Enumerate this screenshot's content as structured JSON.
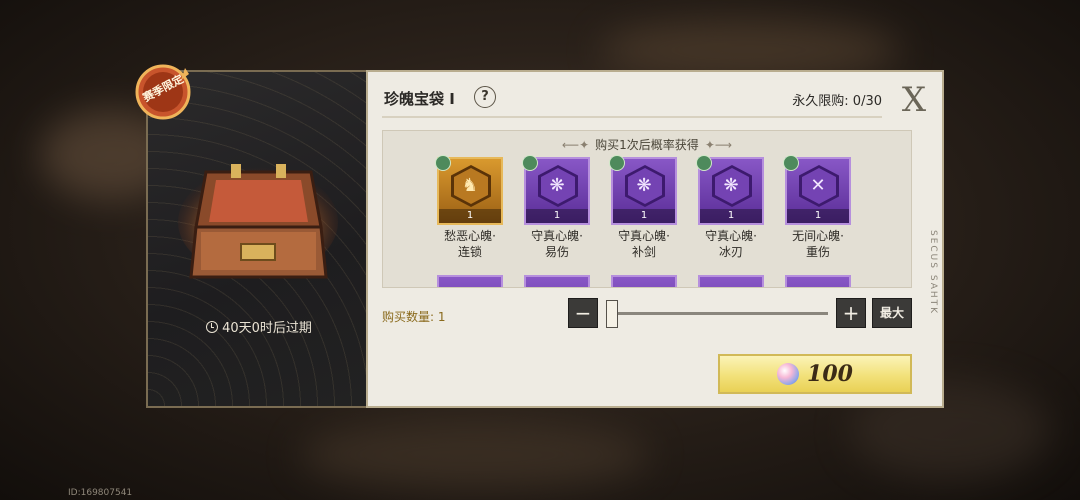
{
  "season_badge": "赛季限定",
  "chest": {
    "expire_text": "40天0时后过期"
  },
  "header": {
    "title": "珍魄宝袋 I",
    "help_symbol": "?",
    "limit_text": "永久限购: 0/30",
    "close_symbol": "X"
  },
  "items_caption": "购买1次后概率获得",
  "items": [
    {
      "name_line1": "愁恶心魄·",
      "name_line2": "连锁",
      "count": "1",
      "rarity": "gold",
      "glyph": "♞"
    },
    {
      "name_line1": "守真心魄·",
      "name_line2": "易伤",
      "count": "1",
      "rarity": "purple",
      "glyph": "❋"
    },
    {
      "name_line1": "守真心魄·",
      "name_line2": "补剑",
      "count": "1",
      "rarity": "purple",
      "glyph": "❋"
    },
    {
      "name_line1": "守真心魄·",
      "name_line2": "冰刃",
      "count": "1",
      "rarity": "purple",
      "glyph": "❋"
    },
    {
      "name_line1": "无间心魄·",
      "name_line2": "重伤",
      "count": "1",
      "rarity": "purple",
      "glyph": "✕"
    }
  ],
  "quantity": {
    "label": "购买数量: 1",
    "value": 1,
    "fraction": 0.0,
    "minus": "−",
    "plus": "+",
    "max_label": "最大"
  },
  "buy": {
    "price": "100",
    "currency_icon": "gem-icon"
  },
  "side_decoration": "SECUS SAHTK",
  "id_text": "ID:169807541",
  "colors": {
    "gold_tile": "#d9992e",
    "purple_tile": "#8857c6",
    "buy_button": "#f2e17a",
    "qty_label": "#8a6a1c"
  }
}
